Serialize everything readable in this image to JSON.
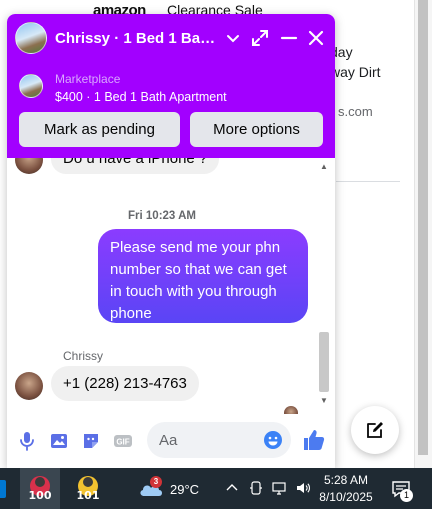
{
  "background": {
    "amazon_logo_text": "amazon",
    "promo_text": "Clearance Sale",
    "right_text_lines": [
      "day",
      "way Dirt"
    ],
    "right_url_fragment": "s.com"
  },
  "chat": {
    "contact_title": "Chrissy · 1 Bed 1 Bath Apartment",
    "marketplace": {
      "label": "Marketplace",
      "listing": "$400 · 1 Bed 1 Bath Apartment"
    },
    "buttons": {
      "mark_pending": "Mark as pending",
      "more_options": "More options"
    },
    "messages": {
      "partial_previous": "Do u have a iPhone ?",
      "timestamp": "Fri 10:23 AM",
      "sent": "Please send me your phn\nnumber so that we can get\nin touch with you through\nphone",
      "sender_name": "Chrissy",
      "received": "+1 (228) 213-4763"
    },
    "composer": {
      "placeholder": "Aa"
    },
    "accent_color": "#a200ff"
  },
  "taskbar": {
    "apps": [
      {
        "badge": "100",
        "icon": "red-app-icon"
      },
      {
        "badge": "101",
        "icon": "yellow-app-icon"
      }
    ],
    "weather": {
      "badge": "3",
      "temperature": "29°C"
    },
    "clock": {
      "time": "5:28 AM",
      "date": "8/10/2025"
    },
    "notification_count": "1"
  }
}
